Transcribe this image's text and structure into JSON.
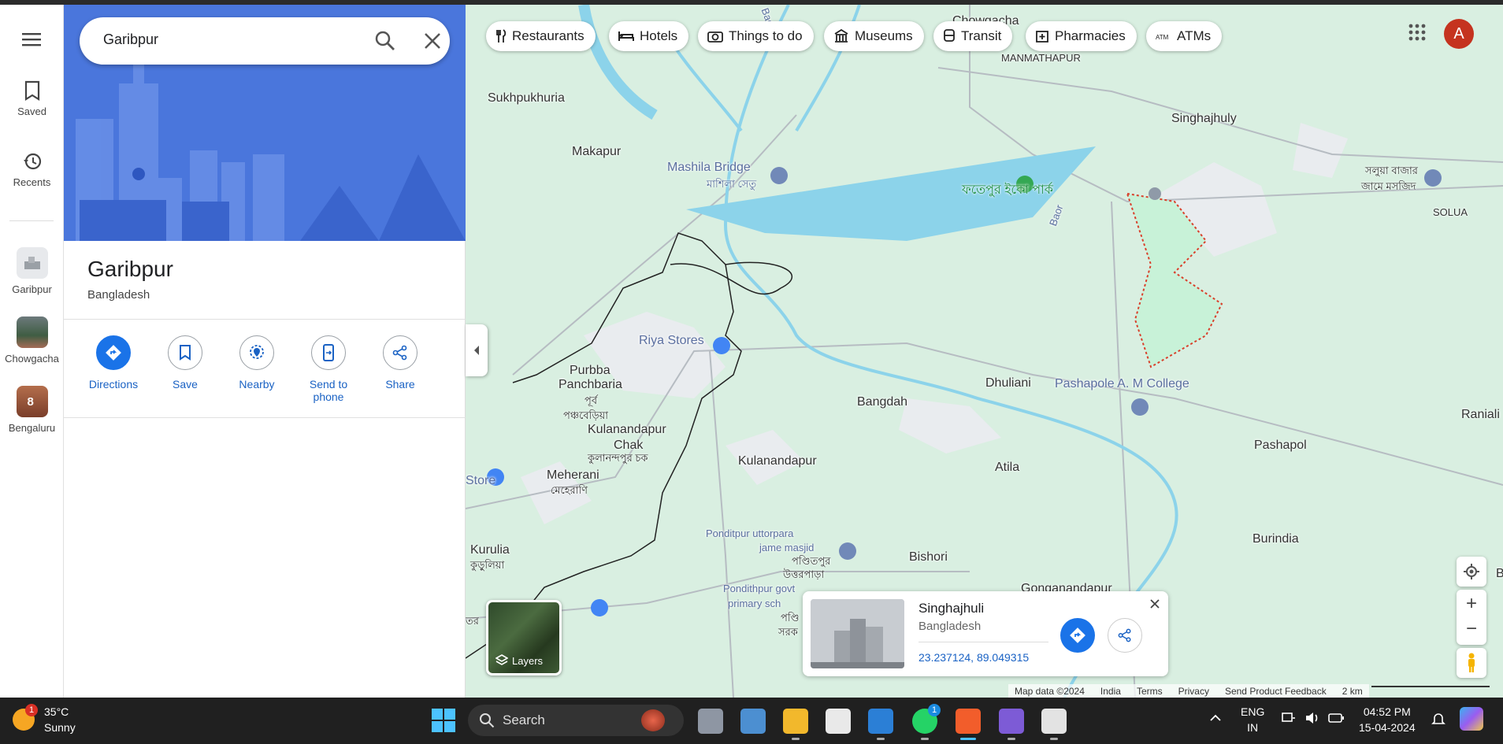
{
  "search": {
    "value": "Garibpur"
  },
  "rail": {
    "saved": "Saved",
    "recents": "Recents",
    "recent_items": [
      "Garibpur",
      "Chowgacha",
      "Bengaluru"
    ],
    "bengaluru_badge": "8"
  },
  "place": {
    "title": "Garibpur",
    "subtitle": "Bangladesh",
    "actions": {
      "directions": "Directions",
      "save": "Save",
      "nearby": "Nearby",
      "send_line1": "Send to",
      "send_line2": "phone",
      "share": "Share"
    }
  },
  "chips": [
    "Restaurants",
    "Hotels",
    "Things to do",
    "Museums",
    "Transit",
    "Pharmacies",
    "ATMs"
  ],
  "avatar": "A",
  "map_labels": {
    "chowgacha": "Chowgacha",
    "manmathapur": "MANMATHAPUR",
    "sukhpukhuria": "Sukhpukhuria",
    "makapur": "Makapur",
    "singhajhuly": "Singhajhuly",
    "mashila_bridge": "Mashila Bridge",
    "mashila_bn": "মাশিলা সেতু",
    "eco_park": "ফতেপুর ইকো পার্ক",
    "baor": "Baor",
    "baor_top": "Bao",
    "soluabazar_1": "সলুয়া বাজার",
    "soluabazar_2": "জামে মসজিদ",
    "solua": "SOLUA",
    "riya_stores": "Riya Stores",
    "purbba_1": "Purbba",
    "purbba_2": "Panchbaria",
    "purbba_bn_1": "পূর্ব",
    "purbba_bn_2": "পঞ্চবেড়িয়া",
    "bangdah": "Bangdah",
    "dhuliani": "Dhuliani",
    "pashapole_college": "Pashapole A. M College",
    "raniali": "Raniali",
    "kulanandapur_chak_1": "Kulanandapur",
    "kulanandapur_chak_2": "Chak",
    "kulanandapur_chak_bn": "কুলানন্দপুর চক",
    "kulanandapur": "Kulanandapur",
    "pashapol": "Pashapol",
    "store": "Store",
    "meherani": "Meherani",
    "meherani_bn": "মেহেরাণি",
    "atila": "Atila",
    "ponditpur_1": "Ponditpur uttorpara",
    "ponditpur_2": "jame masjid",
    "ponditpur_bn_1": "পণ্ডিতপুর",
    "ponditpur_bn_2": "উত্তরপাড়া",
    "kurulia": "Kurulia",
    "kurulia_bn": "কুড়ুলিয়া",
    "burindia": "Burindia",
    "bishori": "Bishori",
    "gonganandapur": "Gonganandapur",
    "pondithpur_school_1": "Pondithpur govt",
    "pondithpur_school_2": "primary sch",
    "pondithpur_school_bn_1": "পণ্ডি",
    "pondithpur_school_bn_2": "সরক",
    "left_edge": "তর",
    "right_edge": "B"
  },
  "layers_label": "Layers",
  "card": {
    "title": "Singhajhuli",
    "subtitle": "Bangladesh",
    "coords": "23.237124, 89.049315"
  },
  "footer": {
    "map_data": "Map data ©2024",
    "india": "India",
    "terms": "Terms",
    "privacy": "Privacy",
    "feedback": "Send Product Feedback",
    "scale": "2 km"
  },
  "taskbar": {
    "temp": "35°C",
    "condition": "Sunny",
    "weather_badge": "1",
    "search_placeholder": "Search",
    "whatsapp_badge": "1",
    "lang_1": "ENG",
    "lang_2": "IN",
    "time": "04:52 PM",
    "date": "15-04-2024"
  },
  "colors": {
    "accent": "#1a73e8",
    "avatar": "#c5331f",
    "map_bg": "#d9efe1",
    "water": "#8cd3ea"
  }
}
